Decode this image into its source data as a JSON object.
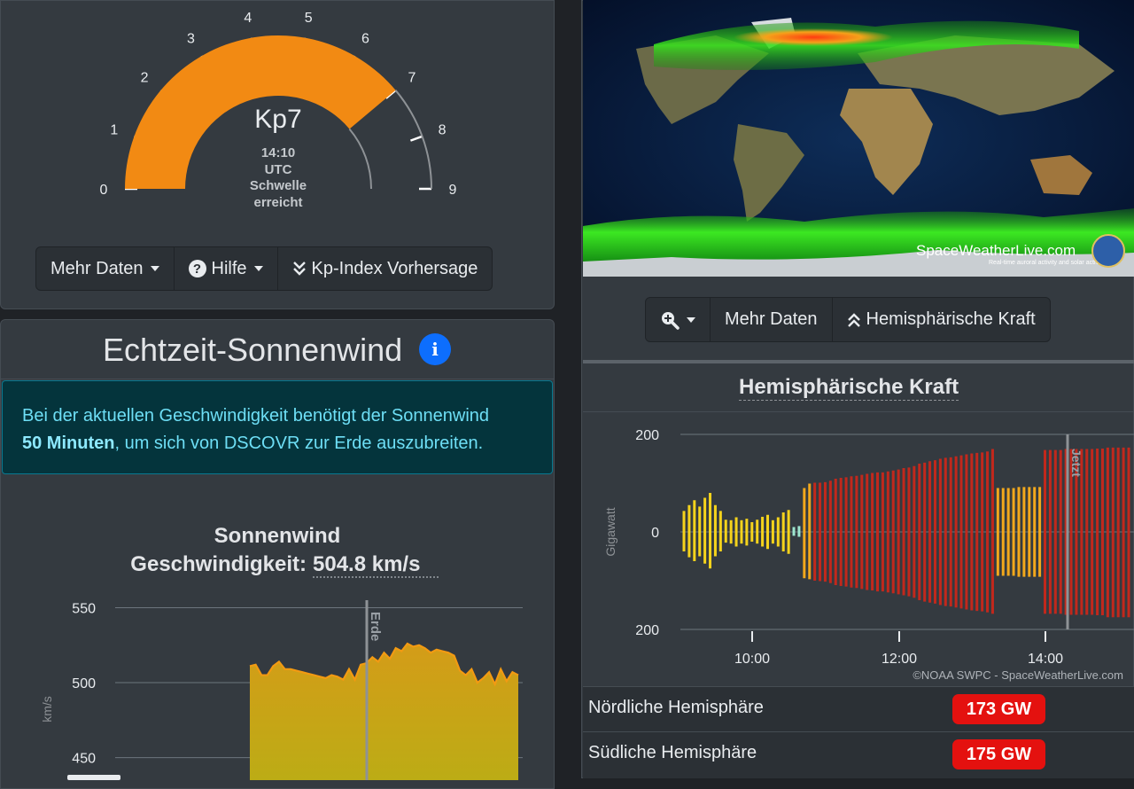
{
  "kp_gauge": {
    "value": "Kp7",
    "level": 7,
    "max": 9,
    "time": "14:10",
    "timezone": "UTC",
    "status_line1": "Schwelle",
    "status_line2": "erreicht",
    "ticks": [
      "0",
      "1",
      "2",
      "3",
      "4",
      "5",
      "6",
      "7",
      "8",
      "9"
    ],
    "fill_color": "#f28a13"
  },
  "kp_toolbar": {
    "more_data": "Mehr Daten",
    "help": "Hilfe",
    "help_icon": "?",
    "forecast": "Kp-Index Vorhersage"
  },
  "solar_wind": {
    "title": "Echtzeit-Sonnenwind",
    "info_icon": "i",
    "alert_part1": "Bei der aktuellen Geschwindigkeit benötigt der Sonnenwind",
    "alert_bold": "50 Minuten",
    "alert_part2": ", um sich von DSCOVR zur Erde auszubreiten.",
    "chart_title": "Sonnenwind",
    "chart_subtitle_label": "Geschwindigkeit:",
    "chart_subtitle_value": "504.8 km/s"
  },
  "map": {
    "watermark": "SpaceWeatherLive.com",
    "tagline": "Real-time auroral activity and solar activity"
  },
  "map_toolbar": {
    "zoom_icon": "zoom-in-icon",
    "more_data": "Mehr Daten",
    "hemispheric": "Hemisphärische Kraft"
  },
  "hemi_chart": {
    "title": "Hemisphärische Kraft",
    "ylabel": "Gigawatt",
    "now_label": "Jetzt",
    "credit": "©NOAA SWPC - SpaceWeatherLive.com",
    "y_ticks": [
      "200",
      "0",
      "200"
    ],
    "x_ticks": [
      "10:00",
      "12:00",
      "14:00"
    ]
  },
  "hemi_values": {
    "north_label": "Nördliche Hemisphäre",
    "north_value": "173 GW",
    "south_label": "Südliche Hemisphäre",
    "south_value": "175 GW"
  },
  "chart_data": [
    {
      "type": "area",
      "title": "Sonnenwind",
      "subtitle": "Geschwindigkeit: 504.8 km/s",
      "ylabel": "km/s",
      "y_ticks": [
        "550",
        "500",
        "450"
      ],
      "ylim": [
        435,
        555
      ],
      "marker_label": "Erde",
      "color": "#f29a12",
      "values": [
        511,
        512,
        505,
        505,
        511,
        514,
        509,
        509,
        508,
        507,
        506,
        505,
        504,
        503,
        505,
        504,
        502,
        509,
        502,
        512,
        513,
        517,
        514,
        520,
        516,
        523,
        521,
        526,
        524,
        525,
        523,
        520,
        522,
        521,
        520,
        518,
        508,
        505,
        509,
        500,
        503,
        507,
        499,
        509,
        501,
        507,
        505
      ]
    },
    {
      "type": "bar",
      "title": "Hemisphärische Kraft",
      "ylabel": "Gigawatt",
      "ylim": [
        -200,
        200
      ],
      "x_ticks": [
        "10:00",
        "12:00",
        "14:00"
      ],
      "marker_label": "Jetzt",
      "north": [
        43,
        55,
        65,
        52,
        70,
        80,
        55,
        43,
        25,
        24,
        30,
        24,
        27,
        20,
        25,
        31,
        35,
        24,
        30,
        40,
        45,
        10,
        12,
        90,
        99,
        101,
        101,
        102,
        105,
        109,
        111,
        112,
        114,
        115,
        117,
        119,
        121,
        122,
        122,
        124,
        126,
        128,
        131,
        132,
        135,
        140,
        142,
        145,
        147,
        150,
        152,
        153,
        155,
        157,
        159,
        161,
        162,
        163,
        165,
        170,
        90,
        90,
        90,
        90,
        92,
        92,
        92,
        92,
        92,
        168,
        168,
        168,
        168,
        170,
        170,
        170,
        170,
        170,
        170,
        171,
        171,
        173,
        173,
        173,
        173,
        173
      ],
      "south": [
        -40,
        -52,
        -60,
        -50,
        -65,
        -75,
        -50,
        -40,
        -22,
        -24,
        -30,
        -24,
        -28,
        -20,
        -24,
        -30,
        -35,
        -24,
        -30,
        -40,
        -45,
        -8,
        -10,
        -95,
        -97,
        -100,
        -101,
        -102,
        -105,
        -109,
        -111,
        -112,
        -114,
        -115,
        -117,
        -119,
        -120,
        -122,
        -122,
        -124,
        -126,
        -128,
        -130,
        -132,
        -135,
        -140,
        -143,
        -145,
        -147,
        -150,
        -152,
        -153,
        -155,
        -157,
        -159,
        -161,
        -162,
        -163,
        -165,
        -168,
        -90,
        -90,
        -90,
        -90,
        -92,
        -92,
        -92,
        -92,
        -92,
        -168,
        -168,
        -168,
        -168,
        -170,
        -170,
        -170,
        -170,
        -170,
        -170,
        -171,
        -171,
        -175,
        -175,
        -175,
        -175,
        -175
      ]
    }
  ]
}
